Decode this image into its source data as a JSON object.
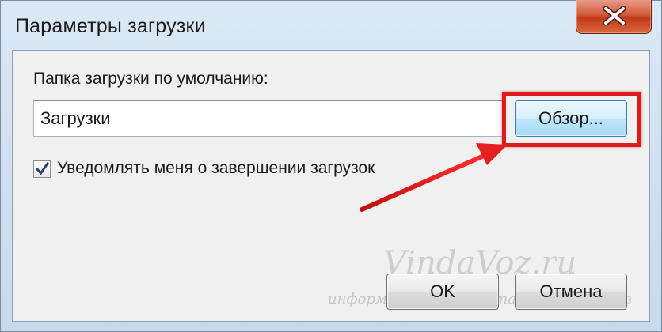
{
  "window": {
    "title": "Параметры загрузки",
    "close_symbol": "close-icon"
  },
  "form": {
    "folder_label": "Папка загрузки по умолчанию:",
    "folder_value": "Загрузки",
    "browse_label": "Обзор...",
    "notify_label": "Уведомлять меня о завершении загрузок",
    "notify_checked": true
  },
  "buttons": {
    "ok_label": "OK",
    "cancel_label": "Отмена"
  },
  "watermark": {
    "logo": "VindaVoz.ru",
    "subtitle": "информационный портал для новичков"
  },
  "colors": {
    "highlight": "#e01919",
    "close_button": "#c03a18",
    "title_bar": "#dbe8f5"
  }
}
